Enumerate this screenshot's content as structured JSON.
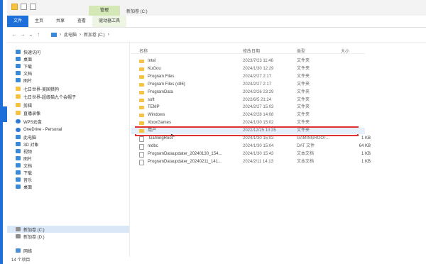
{
  "window": {
    "title": "新加卷 (C:)",
    "context_tab": "管理"
  },
  "ribbon": {
    "tabs": [
      "文件",
      "主页",
      "共享",
      "查看",
      "驱动器工具"
    ]
  },
  "address": {
    "path": [
      "此电脑",
      "新加卷 (C:)"
    ]
  },
  "sidebar": {
    "items": [
      {
        "label": "快速访问",
        "icon": "star-icon"
      },
      {
        "label": "桌面",
        "icon": "desktop-icon"
      },
      {
        "label": "下载",
        "icon": "download-icon"
      },
      {
        "label": "文档",
        "icon": "document-icon"
      },
      {
        "label": "图片",
        "icon": "picture-icon"
      },
      {
        "label": "七日世界-美国猎狗",
        "icon": "folder-icon"
      },
      {
        "label": "七日世界-超级猫九个会帽子",
        "icon": "folder-icon"
      },
      {
        "label": "剪辑",
        "icon": "folder-icon"
      },
      {
        "label": "直播录像",
        "icon": "folder-icon"
      },
      {
        "label": "WPS云盘",
        "icon": "cloud-icon"
      },
      {
        "label": "OneDrive - Personal",
        "icon": "onedrive-icon"
      },
      {
        "label": "此电脑",
        "icon": "computer-icon"
      },
      {
        "label": "3D 对象",
        "icon": "3d-objects-icon"
      },
      {
        "label": "视频",
        "icon": "video-icon"
      },
      {
        "label": "图片",
        "icon": "picture-icon"
      },
      {
        "label": "文档",
        "icon": "document-icon"
      },
      {
        "label": "下载",
        "icon": "download-icon"
      },
      {
        "label": "音乐",
        "icon": "music-icon"
      },
      {
        "label": "桌面",
        "icon": "desktop-icon"
      },
      {
        "label": "新加卷 (C:)",
        "icon": "drive-icon",
        "selected": true
      },
      {
        "label": "新加卷 (D:)",
        "icon": "drive-icon"
      },
      {
        "label": "网络",
        "icon": "network-icon"
      }
    ]
  },
  "columns": {
    "name": "名称",
    "date": "修改日期",
    "type": "类型",
    "size": "大小"
  },
  "files": [
    {
      "name": "Intel",
      "date": "2023/7/23 11:46",
      "type": "文件夹",
      "size": "",
      "kind": "folder"
    },
    {
      "name": "KuGou",
      "date": "2024/1/30 12:29",
      "type": "文件夹",
      "size": "",
      "kind": "folder"
    },
    {
      "name": "Program Files",
      "date": "2024/2/27 2:17",
      "type": "文件夹",
      "size": "",
      "kind": "folder"
    },
    {
      "name": "Program Files (x86)",
      "date": "2024/2/27 2:17",
      "type": "文件夹",
      "size": "",
      "kind": "folder"
    },
    {
      "name": "ProgramData",
      "date": "2024/2/26 23:29",
      "type": "文件夹",
      "size": "",
      "kind": "folder"
    },
    {
      "name": "soft",
      "date": "2022/6/5 21:24",
      "type": "文件夹",
      "size": "",
      "kind": "folder"
    },
    {
      "name": "TEMP",
      "date": "2024/2/27 15:03",
      "type": "文件夹",
      "size": "",
      "kind": "folder"
    },
    {
      "name": "Windows",
      "date": "2024/2/28 14:08",
      "type": "文件夹",
      "size": "",
      "kind": "folder"
    },
    {
      "name": "XboxGames",
      "date": "2024/1/30 15:02",
      "type": "文件夹",
      "size": "",
      "kind": "folder"
    },
    {
      "name": "用户",
      "date": "2022/12/25 10:35",
      "type": "文件夹",
      "size": "",
      "kind": "folder",
      "selected": true
    },
    {
      "name": ".GamingRoot",
      "date": "2024/1/30 15:02",
      "type": "GAMINGROOT...",
      "size": "1 KB",
      "kind": "file"
    },
    {
      "name": "mdbc",
      "date": "2024/1/30 15:04",
      "type": "DAT 文件",
      "size": "64 KB",
      "kind": "file"
    },
    {
      "name": "ProgramDataupdater_20240130_154...",
      "date": "2024/1/30 15:43",
      "type": "文本文档",
      "size": "1 KB",
      "kind": "file"
    },
    {
      "name": "ProgramDataupdater_20240211_141...",
      "date": "2024/2/11 14:13",
      "type": "文本文档",
      "size": "1 KB",
      "kind": "file"
    }
  ],
  "status": {
    "item_count": "14 个项目"
  }
}
